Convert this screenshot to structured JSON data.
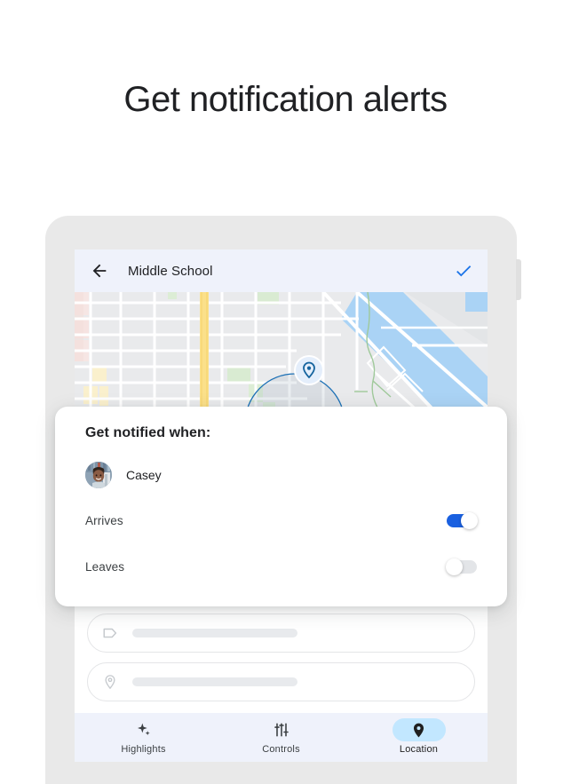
{
  "headline": "Get notification alerts",
  "appbar": {
    "back_icon": "arrow-left-icon",
    "title": "Middle School",
    "confirm_icon": "check-icon",
    "background": "#eff2fb"
  },
  "map": {
    "marker_icon": "location-pin-icon",
    "geofence_stroke": "#1a73e8",
    "water_color": "#aad3f5",
    "highway_color": "#fbe08a"
  },
  "sheet": {
    "title": "Get notified when:",
    "person": {
      "name": "Casey",
      "avatar": "person-avatar"
    },
    "toggles": [
      {
        "label": "Arrives",
        "state": "on",
        "color": "#1a60e0"
      },
      {
        "label": "Leaves",
        "state": "off",
        "color": "#e3e5e8"
      }
    ]
  },
  "form": {
    "fields": [
      {
        "icon": "tag-icon",
        "value": "",
        "placeholder": ""
      },
      {
        "icon": "location-pin-outline-icon",
        "value": "",
        "placeholder": ""
      }
    ]
  },
  "bottom_nav": {
    "items": [
      {
        "label": "Highlights",
        "icon": "sparkle-icon",
        "active": false
      },
      {
        "label": "Controls",
        "icon": "sliders-icon",
        "active": false
      },
      {
        "label": "Location",
        "icon": "location-pin-filled-icon",
        "active": true
      }
    ],
    "active_pill_color": "#c2e7ff",
    "background": "#eff2fb"
  }
}
